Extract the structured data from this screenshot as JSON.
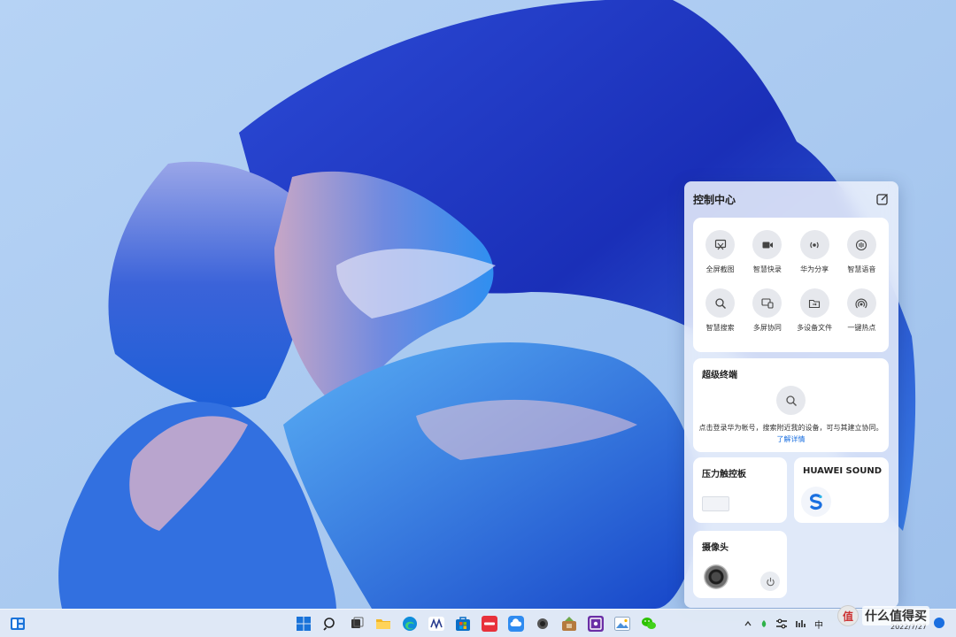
{
  "control_center": {
    "title": "控制中心",
    "quick_actions": [
      {
        "label": "全屏截图",
        "icon": "screenshot-icon"
      },
      {
        "label": "智慧快录",
        "icon": "record-icon"
      },
      {
        "label": "华为分享",
        "icon": "share-icon"
      },
      {
        "label": "智慧语音",
        "icon": "voice-icon"
      },
      {
        "label": "智慧搜索",
        "icon": "search-icon"
      },
      {
        "label": "多屏协同",
        "icon": "multi-screen-icon"
      },
      {
        "label": "多设备文件",
        "icon": "folder-icon"
      },
      {
        "label": "一键热点",
        "icon": "hotspot-icon"
      }
    ],
    "super_device": {
      "title": "超级终端",
      "description": "点击登录华为帐号，搜索附近我的设备，可与其建立协同。",
      "link": "了解详情"
    },
    "touchpad": {
      "title": "压力触控板"
    },
    "sound": {
      "title": "HUAWEI SOUND"
    },
    "camera": {
      "title": "摄像头"
    }
  },
  "taskbar": {
    "apps": [
      {
        "name": "start",
        "icon": "windows-start-icon"
      },
      {
        "name": "search",
        "icon": "search-icon"
      },
      {
        "name": "task-view",
        "icon": "task-view-icon"
      },
      {
        "name": "file-explorer",
        "icon": "folder-icon"
      },
      {
        "name": "edge",
        "icon": "edge-browser-icon"
      },
      {
        "name": "app-bridge",
        "icon": "app-bridge-icon"
      },
      {
        "name": "store",
        "icon": "store-icon"
      },
      {
        "name": "huawei-app",
        "icon": "huawei-red-icon"
      },
      {
        "name": "cloud",
        "icon": "cloud-icon"
      },
      {
        "name": "camera-app",
        "icon": "camera-dot-icon"
      },
      {
        "name": "game",
        "icon": "game-icon"
      },
      {
        "name": "screen-app",
        "icon": "purple-screen-icon"
      },
      {
        "name": "gallery",
        "icon": "gallery-icon"
      },
      {
        "name": "wechat",
        "icon": "wechat-icon"
      }
    ],
    "tray": {
      "ime_label": "中",
      "date": "2022/7/27"
    }
  },
  "watermark": {
    "badge": "值",
    "text": "什么值得买"
  },
  "colors": {
    "accent": "#1a6fe0",
    "panel_bg": "#e8eefa",
    "wallpaper_sky": "#a9c9f0"
  }
}
